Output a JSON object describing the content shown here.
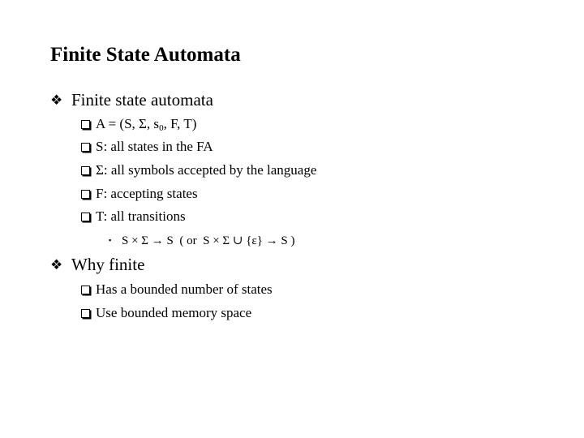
{
  "slide": {
    "title": "Finite State Automata",
    "sections": [
      {
        "bullet_icon": "❖",
        "heading": "Finite state automata",
        "items": [
          {
            "pre": "A = (S, Σ, s",
            "sub": "0",
            "post": ", F, T)"
          },
          {
            "text": "S: all states in the FA"
          },
          {
            "text": "Σ: all symbols accepted by the language"
          },
          {
            "text": "F: accepting states"
          },
          {
            "text": "T: all transitions"
          }
        ],
        "subitem": {
          "bullet_icon": "▪",
          "text": "S × Σ → S  ( or  S × Σ ∪ {ε} → S )"
        }
      },
      {
        "bullet_icon": "❖",
        "heading": "Why finite",
        "items": [
          {
            "text": "Has a bounded number of states"
          },
          {
            "text": "Use bounded memory space"
          }
        ]
      }
    ]
  }
}
